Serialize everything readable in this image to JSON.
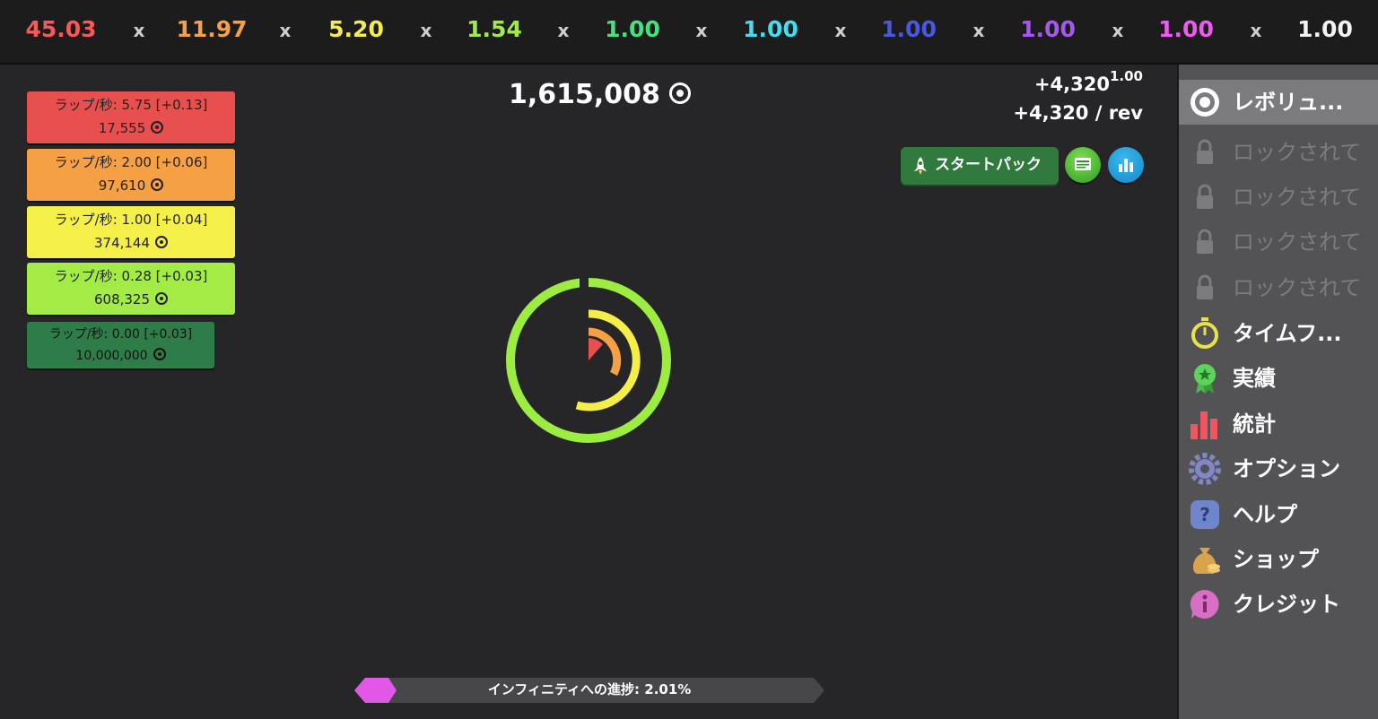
{
  "multipliers": [
    {
      "value": "45.03",
      "color": "#f45a5a"
    },
    {
      "value": "11.97",
      "color": "#f4a14a"
    },
    {
      "value": "5.20",
      "color": "#f5ee4a"
    },
    {
      "value": "1.54",
      "color": "#a3ea47"
    },
    {
      "value": "1.00",
      "color": "#48e07f"
    },
    {
      "value": "1.00",
      "color": "#46dcf0"
    },
    {
      "value": "1.00",
      "color": "#4a58e0"
    },
    {
      "value": "1.00",
      "color": "#a557ee"
    },
    {
      "value": "1.00",
      "color": "#f05af0"
    },
    {
      "value": "1.00",
      "color": "#f2f2f2"
    }
  ],
  "separator": "x",
  "generators": [
    {
      "rate": "ラップ/秒: 5.75 [+0.13]",
      "cost": "17,555",
      "color": "#e8504f"
    },
    {
      "rate": "ラップ/秒: 2.00 [+0.06]",
      "cost": "97,610",
      "color": "#f5a045"
    },
    {
      "rate": "ラップ/秒: 1.00 [+0.04]",
      "cost": "374,144",
      "color": "#f5ef49"
    },
    {
      "rate": "ラップ/秒: 0.28 [+0.03]",
      "cost": "608,325",
      "color": "#a2ec45"
    },
    {
      "rate": "ラップ/秒: 0.00 [+0.03]",
      "cost": "10,000,000",
      "color": "#2e7d49"
    }
  ],
  "total": "1,615,008",
  "rate_per_click": "+4,320",
  "rate_exponent": "1.00",
  "rate_per_rev": "+4,320 / rev",
  "starter_pack_label": "スタートパック",
  "ring": {
    "outer_color": "#9cec42",
    "mid_color": "#f5ee49",
    "inner_color": "#f5a045",
    "core_color": "#e8504f",
    "background": "#262528"
  },
  "progress": {
    "label": "インフィニティへの進捗: 2.01%",
    "percent": 2.01,
    "fill_color": "#e157e6",
    "track_color": "#474649"
  },
  "sidebar": {
    "items": [
      {
        "label": "レボリュ...",
        "icon": "target-icon",
        "state": "active"
      },
      {
        "label": "ロックされて",
        "icon": "lock-icon",
        "state": "locked"
      },
      {
        "label": "ロックされて",
        "icon": "lock-icon",
        "state": "locked"
      },
      {
        "label": "ロックされて",
        "icon": "lock-icon",
        "state": "locked"
      },
      {
        "label": "ロックされて",
        "icon": "lock-icon",
        "state": "locked"
      },
      {
        "label": "タイムフ...",
        "icon": "stopwatch-icon",
        "state": "normal"
      },
      {
        "label": "実績",
        "icon": "medal-icon",
        "state": "normal"
      },
      {
        "label": "統計",
        "icon": "bar-chart-icon",
        "state": "normal"
      },
      {
        "label": "オプション",
        "icon": "gear-icon",
        "state": "normal"
      },
      {
        "label": "ヘルプ",
        "icon": "help-icon",
        "state": "normal"
      },
      {
        "label": "ショップ",
        "icon": "money-bag-icon",
        "state": "normal"
      },
      {
        "label": "クレジット",
        "icon": "info-icon",
        "state": "normal"
      }
    ]
  }
}
